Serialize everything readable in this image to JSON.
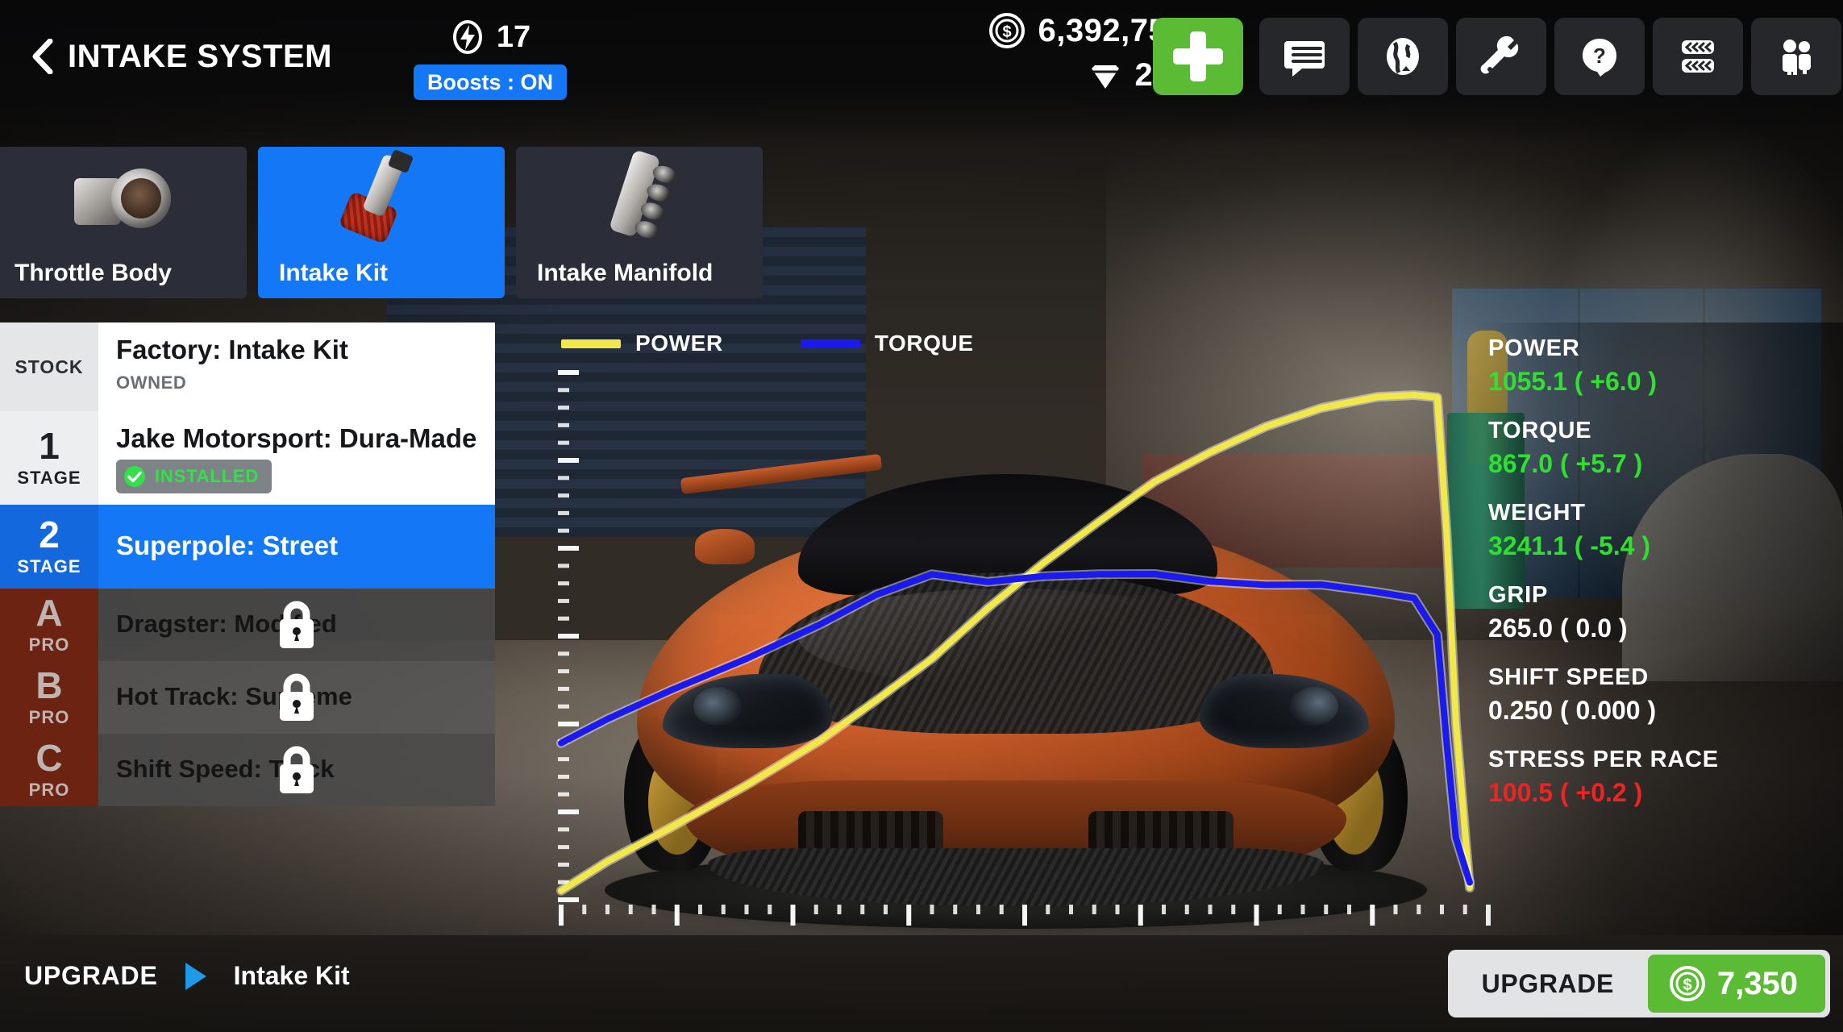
{
  "header": {
    "back_icon": "chevron-left-icon",
    "title": "INTAKE SYSTEM",
    "boost": {
      "icon": "boost-bolt-icon",
      "count": "17",
      "toggle_label": "Boosts : ON"
    },
    "currency": {
      "cash_icon": "coin-dollar-icon",
      "cash": "6,392,753",
      "gem_icon": "gem-icon",
      "gems": "20"
    },
    "add_button": {
      "icon": "plus-icon"
    },
    "icon_buttons": [
      {
        "name": "messages-icon"
      },
      {
        "name": "globe-icon"
      },
      {
        "name": "wrench-icon"
      },
      {
        "name": "help-question-icon"
      },
      {
        "name": "tires-icon"
      },
      {
        "name": "friends-icon"
      }
    ]
  },
  "part_tabs": [
    {
      "label": "Throttle Body",
      "icon": "throttle-body-icon",
      "active": false
    },
    {
      "label": "Intake Kit",
      "icon": "intake-kit-icon",
      "active": true
    },
    {
      "label": "Intake Manifold",
      "icon": "intake-manifold-icon",
      "active": false
    }
  ],
  "upgrade_list": [
    {
      "badge_big": "",
      "badge_small": "STOCK",
      "title": "Factory: Intake Kit",
      "status": "OWNED",
      "locked": false
    },
    {
      "badge_big": "1",
      "badge_small": "STAGE",
      "title": "Jake Motorsport: Dura-Made",
      "status": "INSTALLED",
      "locked": false
    },
    {
      "badge_big": "2",
      "badge_small": "STAGE",
      "title": "Superpole: Street",
      "status": "",
      "locked": false
    },
    {
      "badge_big": "A",
      "badge_small": "PRO",
      "title": "Dragster: Modified",
      "status": "",
      "locked": true
    },
    {
      "badge_big": "B",
      "badge_small": "PRO",
      "title": "Hot Track: Supreme",
      "status": "",
      "locked": true
    },
    {
      "badge_big": "C",
      "badge_small": "PRO",
      "title": "Shift Speed: Track",
      "status": "",
      "locked": true
    }
  ],
  "stats": [
    {
      "key": "POWER",
      "value": "1055.1 ( +6.0 )",
      "tone": "green"
    },
    {
      "key": "TORQUE",
      "value": "867.0 ( +5.7 )",
      "tone": "green"
    },
    {
      "key": "WEIGHT",
      "value": "3241.1 ( -5.4 )",
      "tone": "green"
    },
    {
      "key": "GRIP",
      "value": "265.0 ( 0.0 )",
      "tone": "white"
    },
    {
      "key": "SHIFT SPEED",
      "value": "0.250 ( 0.000 )",
      "tone": "white"
    },
    {
      "key": "STRESS PER RACE",
      "value": "100.5 ( +0.2 )",
      "tone": "red"
    }
  ],
  "footer": {
    "breadcrumb_root": "UPGRADE",
    "breadcrumb_arrow_icon": "triangle-right-icon",
    "breadcrumb_current": "Intake Kit",
    "buy_label": "UPGRADE",
    "buy_price_icon": "coin-dollar-icon",
    "buy_price": "7,350"
  },
  "chart_data": {
    "type": "line",
    "title": "",
    "legend": [
      {
        "name": "POWER",
        "color": "#f2e84a"
      },
      {
        "name": "TORQUE",
        "color": "#1a1af0"
      }
    ],
    "legend_position": "top-left",
    "grid": false,
    "xlabel": "",
    "ylabel": "",
    "x_major_ticks": 8,
    "x_minor_per_major": 5,
    "y_major_ticks": 6,
    "y_minor_per_major": 5,
    "x": [
      0,
      0.05,
      0.12,
      0.2,
      0.28,
      0.34,
      0.4,
      0.46,
      0.52,
      0.58,
      0.64,
      0.7,
      0.76,
      0.82,
      0.88,
      0.92,
      0.945,
      0.955,
      0.965,
      0.98
    ],
    "series": [
      {
        "name": "POWER",
        "color": "#f2e84a",
        "values": [
          0.02,
          0.07,
          0.14,
          0.22,
          0.3,
          0.38,
          0.46,
          0.55,
          0.64,
          0.72,
          0.79,
          0.85,
          0.9,
          0.93,
          0.955,
          0.96,
          0.95,
          0.7,
          0.34,
          0.02
        ]
      },
      {
        "name": "TORQUE",
        "color": "#1a1af0",
        "values": [
          0.3,
          0.34,
          0.4,
          0.46,
          0.52,
          0.58,
          0.62,
          0.6,
          0.615,
          0.62,
          0.615,
          0.605,
          0.6,
          0.595,
          0.585,
          0.575,
          0.5,
          0.3,
          0.12,
          0.03
        ]
      }
    ]
  }
}
